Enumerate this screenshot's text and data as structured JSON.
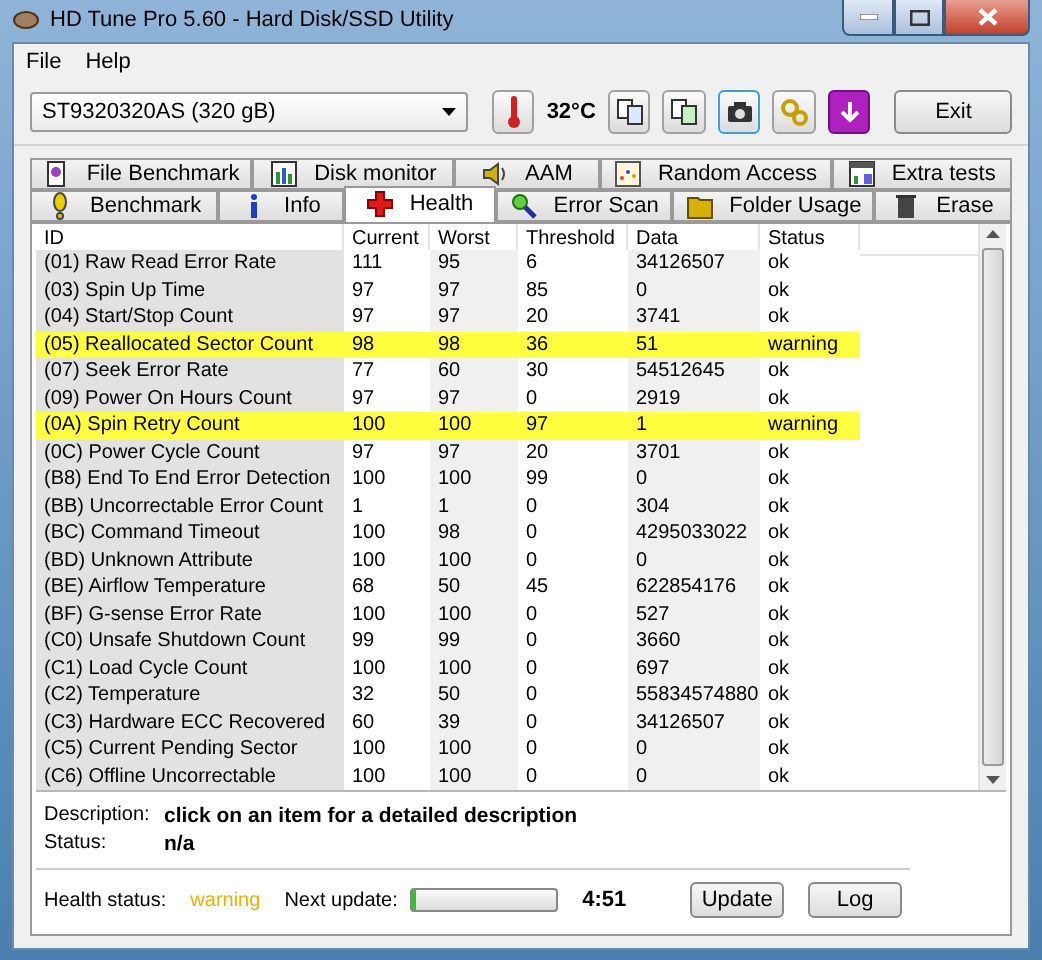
{
  "window": {
    "title": "HD Tune Pro 5.60 - Hard Disk/SSD Utility"
  },
  "menu": [
    "File",
    "Help"
  ],
  "toolbar": {
    "drive": "ST9320320AS (320 gB)",
    "temperature": "32°C",
    "exit": "Exit"
  },
  "tabs_top": [
    {
      "label": "File Benchmark",
      "selected": false
    },
    {
      "label": "Disk monitor",
      "selected": false
    },
    {
      "label": "AAM",
      "selected": false
    },
    {
      "label": "Random Access",
      "selected": false
    },
    {
      "label": "Extra tests",
      "selected": false
    }
  ],
  "tabs_bottom": [
    {
      "label": "Benchmark",
      "selected": false
    },
    {
      "label": "Info",
      "selected": false
    },
    {
      "label": "Health",
      "selected": true
    },
    {
      "label": "Error Scan",
      "selected": false
    },
    {
      "label": "Folder Usage",
      "selected": false
    },
    {
      "label": "Erase",
      "selected": false
    }
  ],
  "table": {
    "columns": [
      "ID",
      "Current",
      "Worst",
      "Threshold",
      "Data",
      "Status"
    ],
    "rows": [
      {
        "cells": [
          "(01) Raw Read Error Rate",
          "111",
          "95",
          "6",
          "34126507",
          "ok"
        ],
        "warning": false
      },
      {
        "cells": [
          "(03) Spin Up Time",
          "97",
          "97",
          "85",
          "0",
          "ok"
        ],
        "warning": false
      },
      {
        "cells": [
          "(04) Start/Stop Count",
          "97",
          "97",
          "20",
          "3741",
          "ok"
        ],
        "warning": false
      },
      {
        "cells": [
          "(05) Reallocated Sector Count",
          "98",
          "98",
          "36",
          "51",
          "warning"
        ],
        "warning": true
      },
      {
        "cells": [
          "(07) Seek Error Rate",
          "77",
          "60",
          "30",
          "54512645",
          "ok"
        ],
        "warning": false
      },
      {
        "cells": [
          "(09) Power On Hours Count",
          "97",
          "97",
          "0",
          "2919",
          "ok"
        ],
        "warning": false
      },
      {
        "cells": [
          "(0A) Spin Retry Count",
          "100",
          "100",
          "97",
          "1",
          "warning"
        ],
        "warning": true
      },
      {
        "cells": [
          "(0C) Power Cycle Count",
          "97",
          "97",
          "20",
          "3701",
          "ok"
        ],
        "warning": false
      },
      {
        "cells": [
          "(B8) End To End Error Detection",
          "100",
          "100",
          "99",
          "0",
          "ok"
        ],
        "warning": false
      },
      {
        "cells": [
          "(BB) Uncorrectable Error Count",
          "1",
          "1",
          "0",
          "304",
          "ok"
        ],
        "warning": false
      },
      {
        "cells": [
          "(BC) Command Timeout",
          "100",
          "98",
          "0",
          "4295033022",
          "ok"
        ],
        "warning": false
      },
      {
        "cells": [
          "(BD) Unknown Attribute",
          "100",
          "100",
          "0",
          "0",
          "ok"
        ],
        "warning": false
      },
      {
        "cells": [
          "(BE) Airflow Temperature",
          "68",
          "50",
          "45",
          "622854176",
          "ok"
        ],
        "warning": false
      },
      {
        "cells": [
          "(BF) G-sense Error Rate",
          "100",
          "100",
          "0",
          "527",
          "ok"
        ],
        "warning": false
      },
      {
        "cells": [
          "(C0) Unsafe Shutdown Count",
          "99",
          "99",
          "0",
          "3660",
          "ok"
        ],
        "warning": false
      },
      {
        "cells": [
          "(C1) Load Cycle Count",
          "100",
          "100",
          "0",
          "697",
          "ok"
        ],
        "warning": false
      },
      {
        "cells": [
          "(C2) Temperature",
          "32",
          "50",
          "0",
          "55834574880",
          "ok"
        ],
        "warning": false
      },
      {
        "cells": [
          "(C3) Hardware ECC Recovered",
          "60",
          "39",
          "0",
          "34126507",
          "ok"
        ],
        "warning": false
      },
      {
        "cells": [
          "(C5) Current Pending Sector",
          "100",
          "100",
          "0",
          "0",
          "ok"
        ],
        "warning": false
      },
      {
        "cells": [
          "(C6) Offline Uncorrectable",
          "100",
          "100",
          "0",
          "0",
          "ok"
        ],
        "warning": false
      }
    ]
  },
  "details": {
    "description_label": "Description:",
    "description": "click on an item for a detailed description",
    "status_label": "Status:",
    "status": "n/a"
  },
  "footer": {
    "health_label": "Health status:",
    "health": "warning",
    "next_label": "Next update:",
    "progress": {
      "level": 0.03
    },
    "countdown": "4:51",
    "buttons": [
      "Update",
      "Log"
    ]
  }
}
